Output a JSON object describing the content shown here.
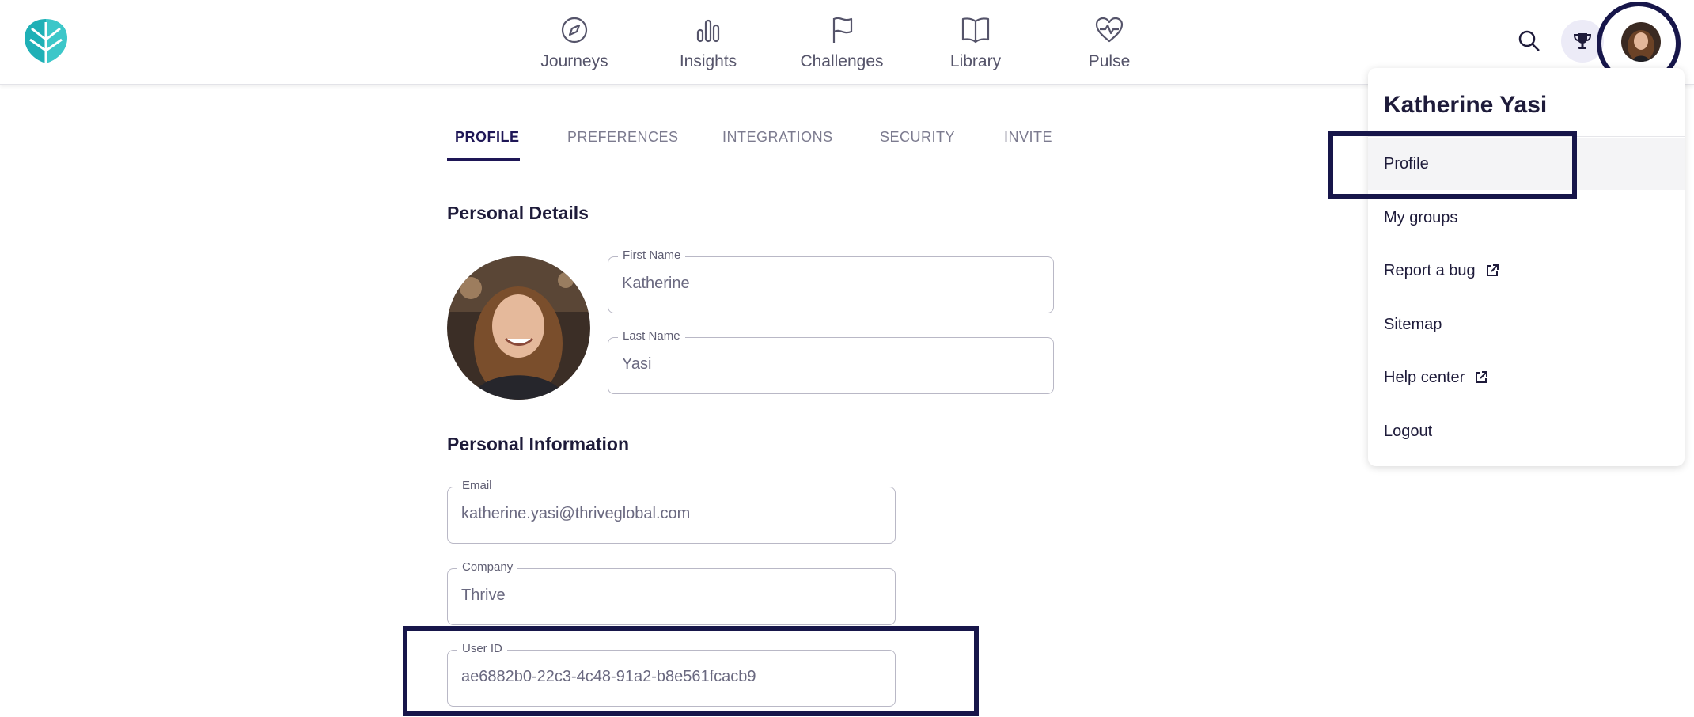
{
  "nav": {
    "items": [
      {
        "label": "Journeys",
        "icon": "compass-icon"
      },
      {
        "label": "Insights",
        "icon": "bar-chart-icon"
      },
      {
        "label": "Challenges",
        "icon": "flag-icon"
      },
      {
        "label": "Library",
        "icon": "book-icon"
      },
      {
        "label": "Pulse",
        "icon": "heart-pulse-icon"
      }
    ]
  },
  "tabs": [
    {
      "label": "PROFILE",
      "active": true
    },
    {
      "label": "PREFERENCES",
      "active": false
    },
    {
      "label": "INTEGRATIONS",
      "active": false
    },
    {
      "label": "SECURITY",
      "active": false
    },
    {
      "label": "INVITE",
      "active": false
    }
  ],
  "personal_details": {
    "title": "Personal Details",
    "first_name": {
      "label": "First Name",
      "value": "Katherine"
    },
    "last_name": {
      "label": "Last Name",
      "value": "Yasi"
    }
  },
  "personal_information": {
    "title": "Personal Information",
    "email": {
      "label": "Email",
      "value": "katherine.yasi@thriveglobal.com"
    },
    "company": {
      "label": "Company",
      "value": "Thrive"
    },
    "user_id": {
      "label": "User ID",
      "value": "ae6882b0-22c3-4c48-91a2-b8e561fcacb9"
    }
  },
  "dropdown": {
    "user_name": "Katherine Yasi",
    "items": [
      {
        "label": "Profile",
        "external": false
      },
      {
        "label": "My groups",
        "external": false
      },
      {
        "label": "Report a bug",
        "external": true
      },
      {
        "label": "Sitemap",
        "external": false
      },
      {
        "label": "Help center",
        "external": true
      },
      {
        "label": "Logout",
        "external": false
      }
    ]
  },
  "colors": {
    "brand_teal": "#2bb5b9",
    "accent_navy": "#1e1656",
    "highlight_navy": "#17164a"
  }
}
